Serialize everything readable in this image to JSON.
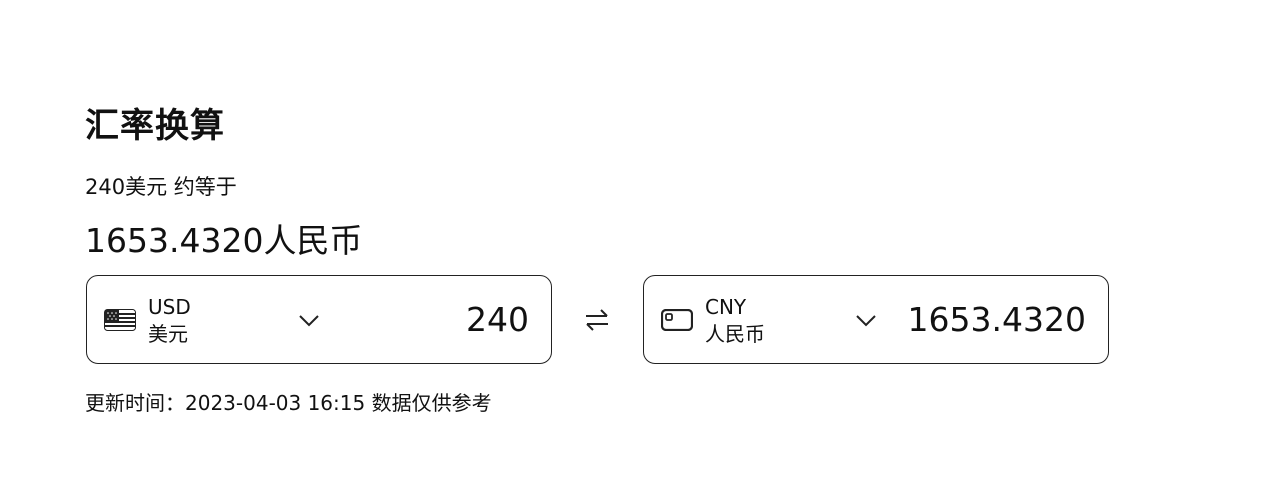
{
  "widget": {
    "title": "汇率换算",
    "subtitle": "240美元 约等于",
    "result": "1653.4320人民币",
    "from": {
      "code": "USD",
      "name": "美元",
      "amount": "240",
      "icon": "us-flag-icon"
    },
    "to": {
      "code": "CNY",
      "name": "人民币",
      "amount": "1653.4320",
      "icon": "currency-card-icon"
    },
    "swap_icon": "swap-arrows-icon",
    "update_text": "更新时间：2023-04-03 16:15 数据仅供参考"
  }
}
